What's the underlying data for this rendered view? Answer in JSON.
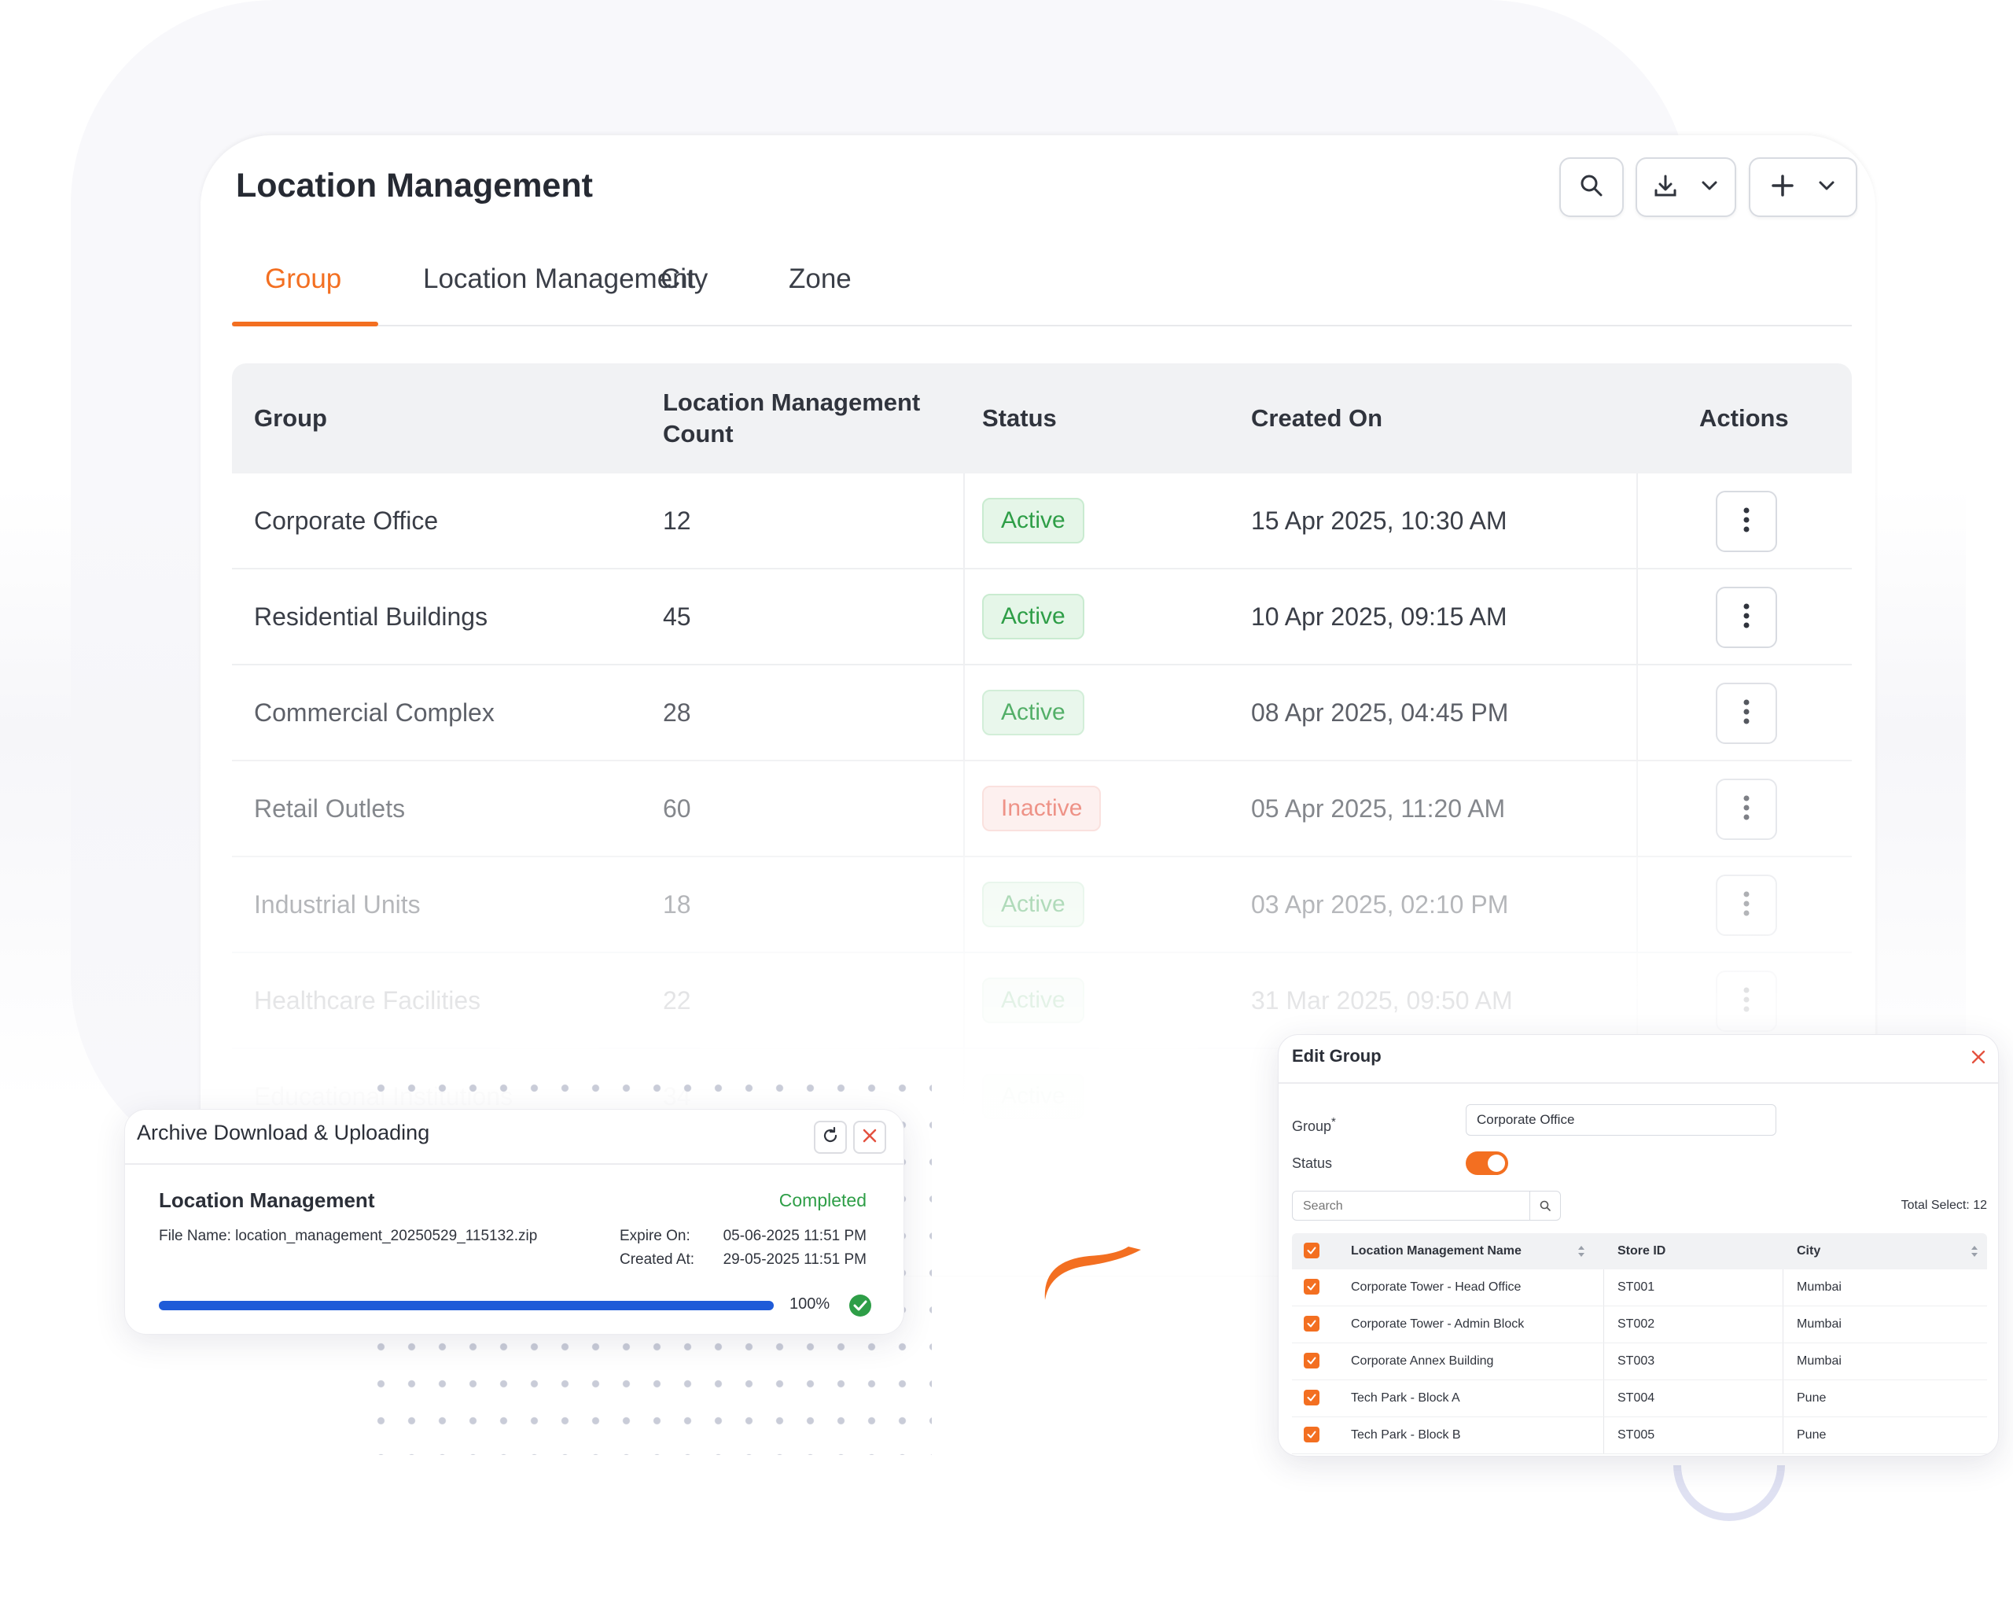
{
  "page": {
    "title": "Location Management",
    "toolbar": {
      "search_icon": "search-icon",
      "download_icon": "download-icon",
      "add_icon": "plus-icon"
    }
  },
  "tabs": [
    {
      "label": "Group"
    },
    {
      "label": "Location Management"
    },
    {
      "label": "City"
    },
    {
      "label": "Zone"
    }
  ],
  "table": {
    "headers": {
      "group": "Group",
      "count_line1": "Location Management",
      "count_line2": "Count",
      "status": "Status",
      "created": "Created On",
      "actions": "Actions"
    },
    "rows": [
      {
        "group": "Corporate Office",
        "count": "12",
        "status": "Active",
        "created": "15 Apr 2025, 10:30 AM"
      },
      {
        "group": "Residential Buildings",
        "count": "45",
        "status": "Active",
        "created": "10 Apr 2025, 09:15 AM"
      },
      {
        "group": "Commercial Complex",
        "count": "28",
        "status": "Active",
        "created": "08 Apr 2025, 04:45 PM"
      },
      {
        "group": "Retail Outlets",
        "count": "60",
        "status": "Inactive",
        "created": "05 Apr 2025, 11:20 AM"
      },
      {
        "group": "Industrial Units",
        "count": "18",
        "status": "Active",
        "created": "03 Apr 2025, 02:10 PM"
      },
      {
        "group": "Healthcare Facilities",
        "count": "22",
        "status": "Active",
        "created": "31 Mar 2025, 09:50 AM"
      },
      {
        "group": "Educational Institutions",
        "count": "34",
        "status": "Active",
        "created": ""
      }
    ]
  },
  "archive": {
    "title": "Archive Download & Uploading",
    "item_title": "Location Management",
    "status": "Completed",
    "file_label": "File Name: location_management_20250529_115132.zip",
    "expire_label": "Expire On:",
    "expire_value": "05-06-2025 11:51 PM",
    "created_label": "Created At:",
    "created_value": "29-05-2025 11:51 PM",
    "progress": 100,
    "progress_text": "100%"
  },
  "edit_group": {
    "title": "Edit Group",
    "group_label": "Group",
    "group_required_mark": "*",
    "group_value": "Corporate Office",
    "status_label": "Status",
    "status_on": true,
    "search_placeholder": "Search",
    "total_select": "Total Select: 12",
    "columns": {
      "name": "Location Management Name",
      "store": "Store ID",
      "city": "City"
    },
    "rows": [
      {
        "name": "Corporate Tower - Head Office",
        "store": "ST001",
        "city": "Mumbai"
      },
      {
        "name": "Corporate Tower - Admin Block",
        "store": "ST002",
        "city": "Mumbai"
      },
      {
        "name": "Corporate Annex Building",
        "store": "ST003",
        "city": "Mumbai"
      },
      {
        "name": "Tech Park - Block A",
        "store": "ST004",
        "city": "Pune"
      },
      {
        "name": "Tech Park - Block B",
        "store": "ST005",
        "city": "Pune"
      }
    ]
  },
  "colors": {
    "accent": "#f36f21",
    "active": "#2e9e47",
    "inactive": "#e4513f",
    "progress": "#1f5bd8"
  }
}
